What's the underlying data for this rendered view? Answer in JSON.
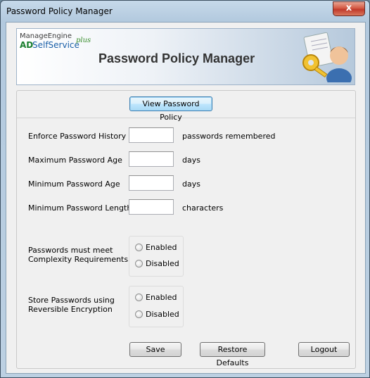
{
  "window": {
    "title": "Password Policy Manager",
    "close_glyph": "x"
  },
  "banner": {
    "brand_top": "ManageEngine",
    "brand_ad": "AD",
    "brand_product": "SelfService",
    "brand_plus": "plus",
    "title": "Password Policy Manager",
    "art_icon": "key-and-user-icon"
  },
  "actions": {
    "view_policy": "View Password Policy"
  },
  "fields": [
    {
      "label": "Enforce Password History",
      "value": "",
      "suffix": "passwords remembered"
    },
    {
      "label": "Maximum Password Age",
      "value": "",
      "suffix": "days"
    },
    {
      "label": "Minimum Password Age",
      "value": "",
      "suffix": "days"
    },
    {
      "label": "Minimum Password Length",
      "value": "",
      "suffix": "characters"
    }
  ],
  "complexity": {
    "label_line1": "Passwords must meet",
    "label_line2": "Complexity Requirements",
    "options": [
      "Enabled",
      "Disabled"
    ],
    "selected": null
  },
  "reversible": {
    "label_line1": "Store Passwords using",
    "label_line2": "Reversible Encryption",
    "options": [
      "Enabled",
      "Disabled"
    ],
    "selected": null
  },
  "footer": {
    "save": "Save",
    "restore": "Restore Defaults",
    "logout": "Logout"
  }
}
